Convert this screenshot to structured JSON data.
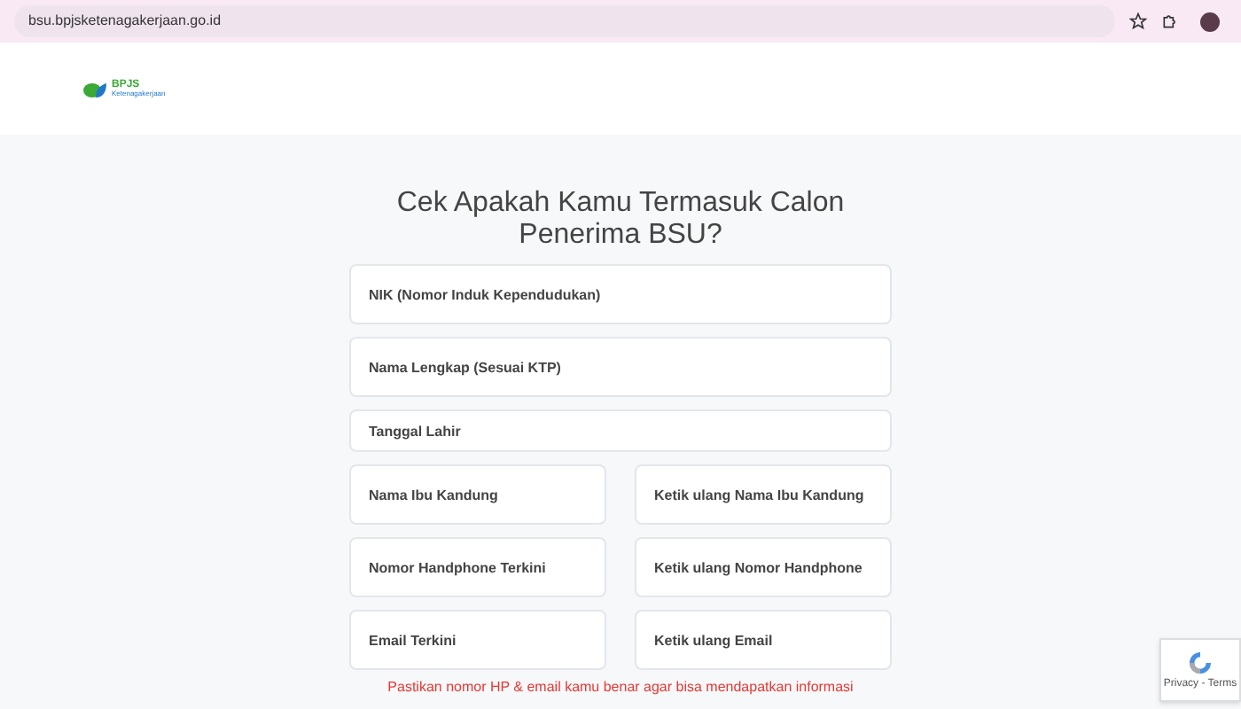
{
  "browser": {
    "url": "bsu.bpjsketenagakerjaan.go.id"
  },
  "header": {
    "logo_title": "BPJS",
    "logo_subtitle": "Ketenagakerjaan"
  },
  "form": {
    "title": "Cek Apakah Kamu Termasuk Calon Penerima BSU?",
    "fields": [
      {
        "kind": "full",
        "placeholder": "NIK (Nomor Induk Kependudukan)"
      },
      {
        "kind": "full",
        "placeholder": "Nama Lengkap (Sesuai KTP)"
      },
      {
        "kind": "short",
        "placeholder": "Tanggal Lahir"
      },
      {
        "kind": "half",
        "placeholder": "Nama Ibu Kandung"
      },
      {
        "kind": "half",
        "placeholder": "Ketik ulang Nama Ibu Kandung"
      },
      {
        "kind": "half",
        "placeholder": "Nomor Handphone Terkini"
      },
      {
        "kind": "half",
        "placeholder": "Ketik ulang Nomor Handphone"
      },
      {
        "kind": "half",
        "placeholder": "Email Terkini"
      },
      {
        "kind": "half",
        "placeholder": "Ketik ulang Email"
      }
    ],
    "notice": "Pastikan nomor HP & email kamu benar agar bisa mendapatkan informasi"
  },
  "recaptcha": {
    "links": "Privacy - Terms"
  }
}
